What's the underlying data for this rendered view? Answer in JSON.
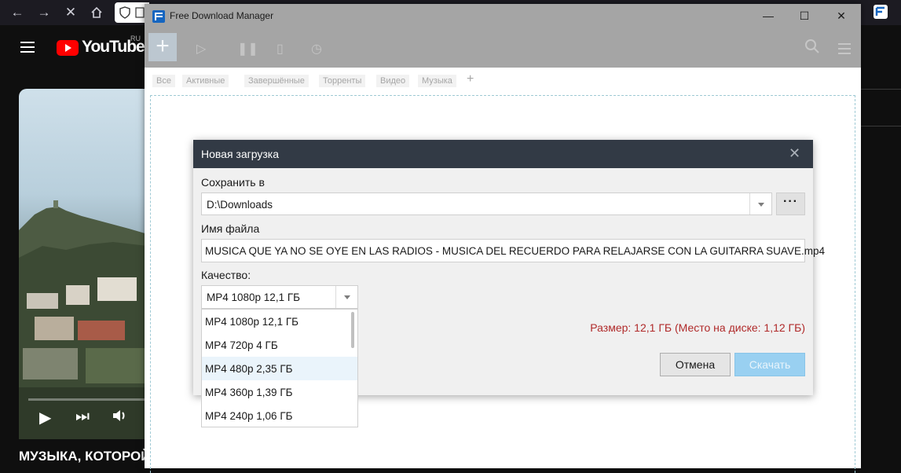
{
  "youtube": {
    "logo_text": "YouTube",
    "region": "RU",
    "video_title": "МУЗЫКА, КОТОРОЙ"
  },
  "fdm": {
    "window_title": "Free Download Manager",
    "tabs": [
      "Все",
      "Активные",
      "Завершённые",
      "Торренты",
      "Видео",
      "Музыка"
    ],
    "tab_add": "+"
  },
  "dialog": {
    "title": "Новая загрузка",
    "save_to_label": "Сохранить в",
    "save_path": "D:\\Downloads",
    "browse_label": "···",
    "filename_label": "Имя файла",
    "filename": "MUSICA QUE YA NO SE OYE EN LAS RADIOS - MUSICA DEL RECUERDO PARA RELAJARSE CON LA GUITARRA SUAVE.mp4",
    "quality_label": "Качество:",
    "quality_selected": "MP4 1080p 12,1 ГБ",
    "quality_options": [
      "MP4 1080p 12,1 ГБ",
      "MP4 720p 4 ГБ",
      "MP4 480p 2,35 ГБ",
      "MP4 360p 1,39 ГБ",
      "MP4 240p 1,06 ГБ"
    ],
    "size_info": "Размер: 12,1 ГБ (Место на диске: 1,12 ГБ)",
    "cancel_label": "Отмена",
    "download_label": "Скачать"
  },
  "colors": {
    "dialog_header": "#323a45",
    "size_warning": "#b02a2a",
    "download_button": "#99d0f1",
    "highlight": "#eaf4fb"
  }
}
